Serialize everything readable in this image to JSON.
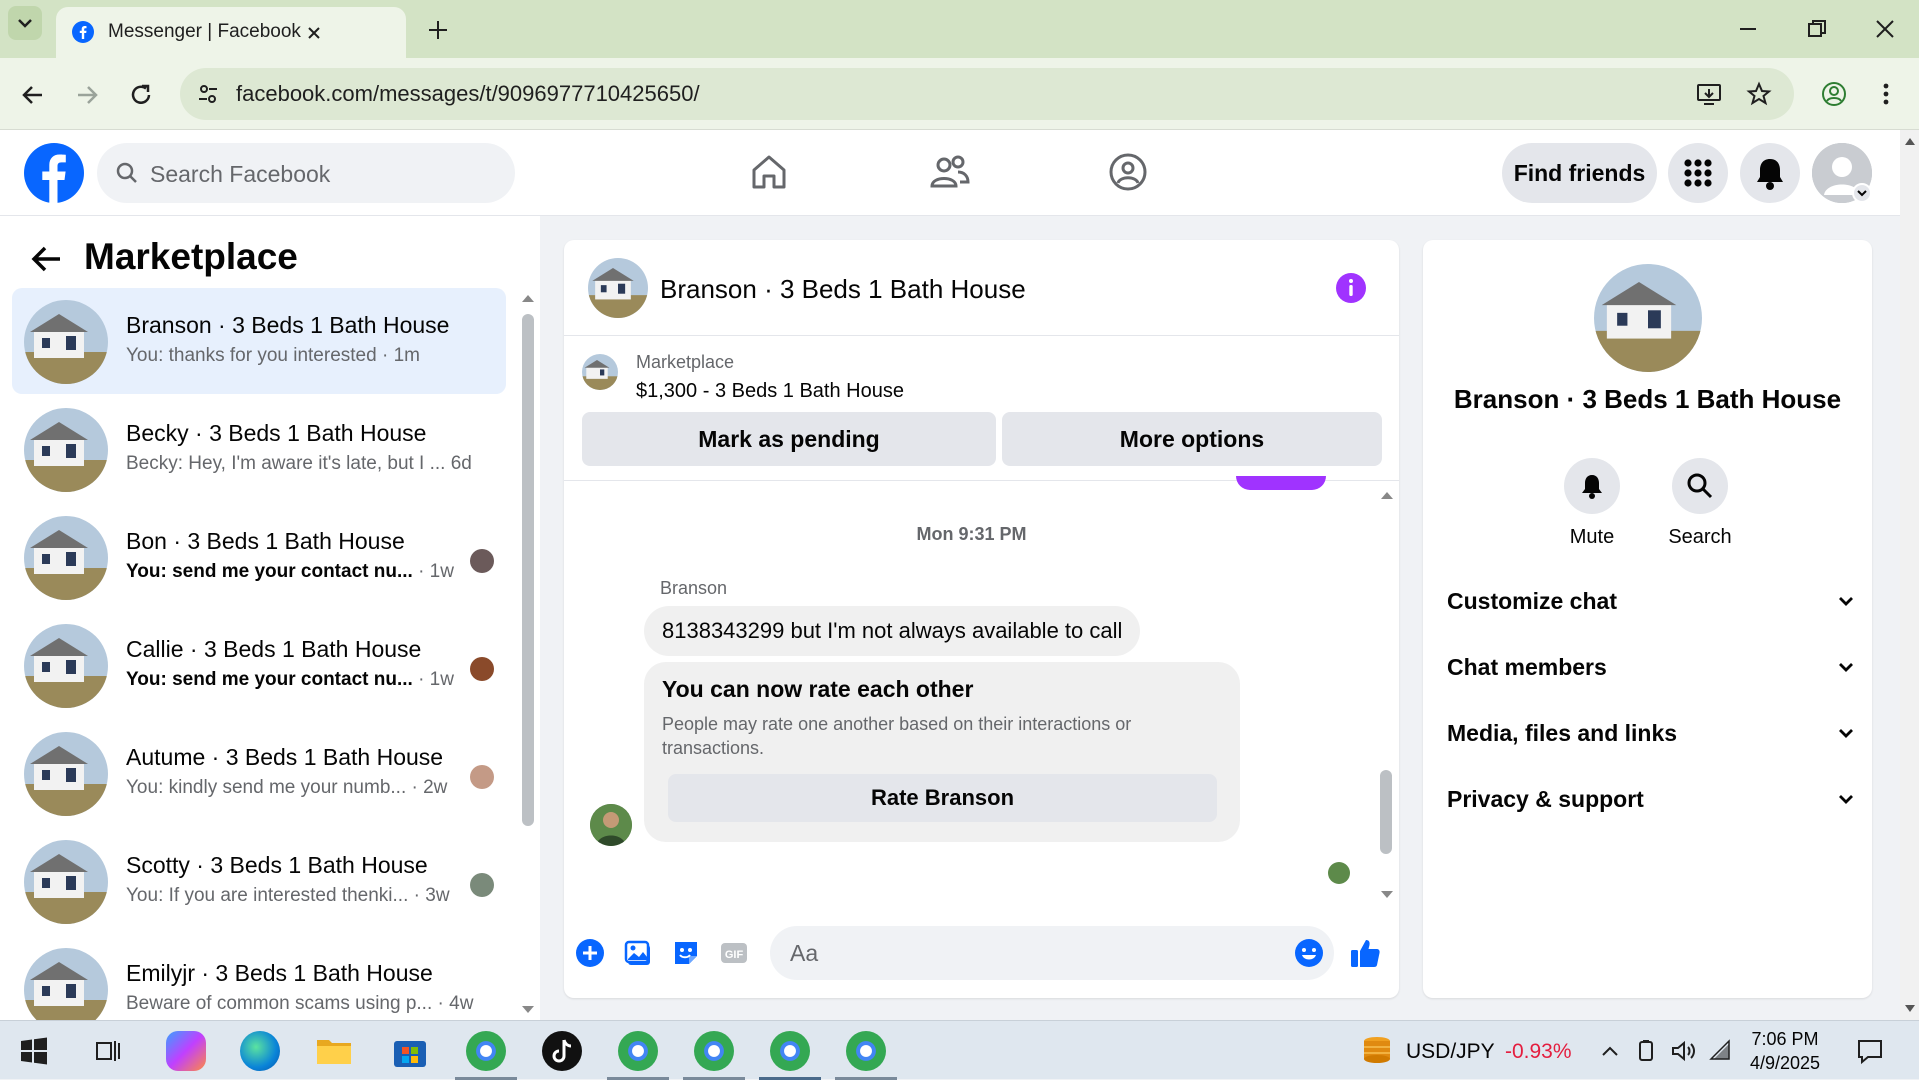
{
  "browser": {
    "tab_title": "Messenger | Facebook",
    "url": "facebook.com/messages/t/9096977710425650/"
  },
  "fb_header": {
    "search_placeholder": "Search Facebook",
    "find_friends_label": "Find friends"
  },
  "left_panel": {
    "title": "Marketplace",
    "conversations": [
      {
        "name": "Branson · 3 Beds 1 Bath House",
        "preview": "You: thanks for you interested · 1m",
        "active": true
      },
      {
        "name": "Becky · 3 Beds 1 Bath House",
        "preview": "Becky: Hey, I'm aware it's late, but I ... 6d"
      },
      {
        "name": "Bon · 3 Beds 1 Bath House",
        "preview_bold": "You: send me your contact nu...",
        "preview_time": " · 1w"
      },
      {
        "name": "Callie · 3 Beds 1 Bath House",
        "preview_bold": "You: send me your contact nu...",
        "preview_time": " · 1w"
      },
      {
        "name": "Autume · 3 Beds 1 Bath House",
        "preview": "You: kindly send me your numb... · 2w"
      },
      {
        "name": "Scotty · 3 Beds 1 Bath House",
        "preview": "You: If you are interested thenki... · 3w"
      },
      {
        "name": "Emilyjr · 3 Beds 1 Bath House",
        "preview": "Beware of common scams using p... · 4w"
      }
    ]
  },
  "chat": {
    "title": "Branson · 3 Beds 1 Bath House",
    "marketplace_label": "Marketplace",
    "listing": "$1,300 - 3 Beds 1 Bath House",
    "mark_pending_label": "Mark as pending",
    "more_options_label": "More options",
    "timestamp": "Mon 9:31 PM",
    "sender": "Branson",
    "message": "8138343299 but I'm not always available to call",
    "card": {
      "title": "You can now rate each other",
      "description": "People may rate one another based on their interactions or transactions.",
      "button": "Rate Branson"
    },
    "composer_placeholder": "Aa"
  },
  "right_panel": {
    "name": "Branson · 3 Beds 1 Bath House",
    "mute_label": "Mute",
    "search_label": "Search",
    "sections": [
      "Customize chat",
      "Chat members",
      "Media, files and links",
      "Privacy & support"
    ]
  },
  "taskbar": {
    "ticker": "USD/JPY",
    "change": "-0.93%",
    "time": "7:06 PM",
    "date": "4/9/2025"
  },
  "colors": {
    "fb_blue": "#0866ff",
    "messenger_purple": "#a033ff",
    "active_conversation": "#e7f0fd"
  }
}
